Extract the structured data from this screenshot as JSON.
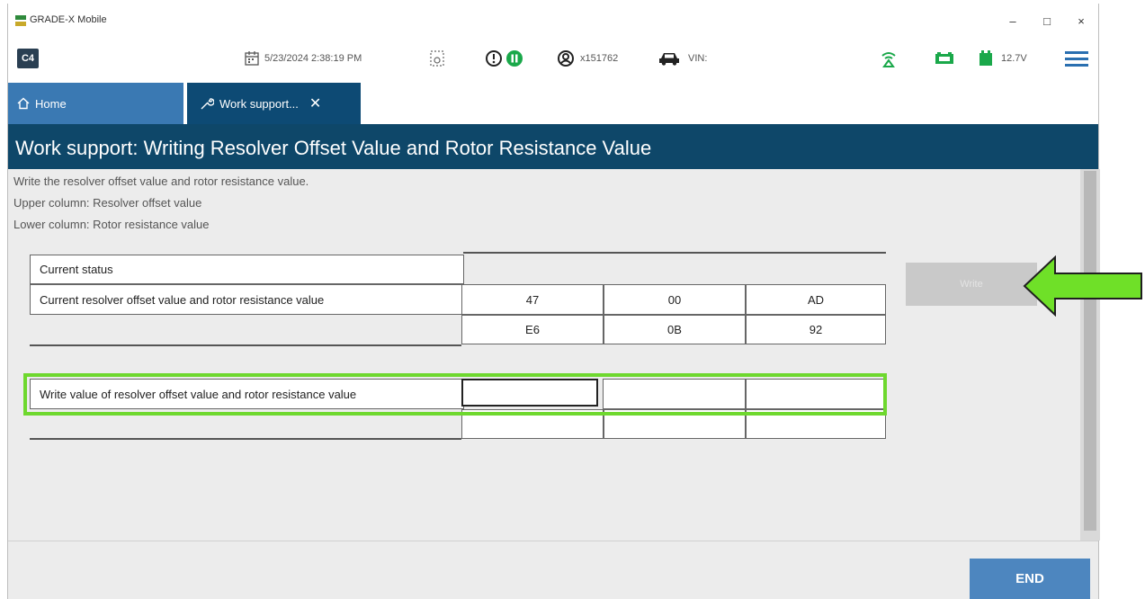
{
  "window": {
    "title": "GRADE-X Mobile",
    "minimize": "–",
    "maximize": "□",
    "close": "×"
  },
  "toolbar": {
    "app_badge": "C4",
    "datetime": "5/23/2024 2:38:19 PM",
    "user": "x151762",
    "vin_label": "VIN:",
    "voltage": "12.7V",
    "icons": [
      "calendar-icon",
      "screenshot-icon",
      "alert-icon",
      "pause-icon",
      "user-icon",
      "car-icon",
      "signal-icon",
      "vi-connection-icon",
      "battery-icon",
      "menu-icon"
    ],
    "accent_green": "#1aa84a"
  },
  "tabs": [
    {
      "label": "Home",
      "icon": "home-icon"
    },
    {
      "label": "Work support...",
      "icon": "wrench-icon",
      "close": "✕"
    }
  ],
  "page": {
    "title": "Work support: Writing Resolver Offset Value and Rotor Resistance Value",
    "description": [
      "Write the resolver offset value and rotor resistance value.",
      "Upper column: Resolver offset value",
      "Lower column: Rotor resistance value"
    ]
  },
  "table": {
    "status_label": "Current status",
    "current_label": "Current resolver offset value and rotor resistance value",
    "current_upper": [
      "47",
      "00",
      "AD"
    ],
    "current_lower": [
      "E6",
      "0B",
      "92"
    ],
    "write_label": "Write value of resolver offset value and rotor resistance value",
    "write_upper": [
      "",
      "",
      ""
    ],
    "write_lower": [
      "",
      "",
      ""
    ]
  },
  "buttons": {
    "write": "Write",
    "end": "END"
  },
  "colors": {
    "header": "#0e4769",
    "tab_active": "#0d4a74",
    "tab_home": "#3a79b3",
    "highlight": "#6ed82e",
    "end_button": "#4d86bf"
  }
}
